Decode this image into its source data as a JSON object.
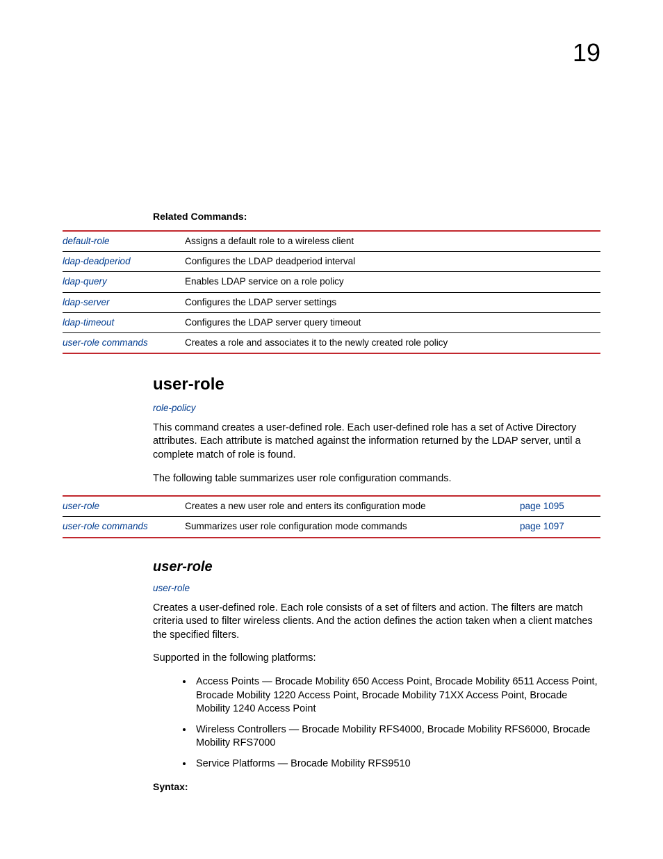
{
  "pageNumber": "19",
  "relatedCommands": {
    "heading": "Related Commands:",
    "rows": [
      {
        "cmd": "default-role",
        "desc": "Assigns a default role to a wireless client"
      },
      {
        "cmd": "ldap-deadperiod",
        "desc": "Configures the LDAP deadperiod interval"
      },
      {
        "cmd": "ldap-query",
        "desc": "Enables LDAP service on a role policy"
      },
      {
        "cmd": "ldap-server",
        "desc": "Configures the LDAP server settings"
      },
      {
        "cmd": "ldap-timeout",
        "desc": "Configures the LDAP server query timeout"
      },
      {
        "cmd": "user-role commands",
        "desc": "Creates a role and associates it to the newly created role policy"
      }
    ]
  },
  "userRoleSection": {
    "heading": "user-role",
    "xref": "role-policy",
    "para1": "This command creates a user-defined role. Each user-defined role has a set of Active Directory attributes. Each attribute is matched against the information returned by the LDAP server, until a complete match of role is found.",
    "para2": "The following table summarizes user role configuration commands.",
    "tableRows": [
      {
        "cmd": "user-role",
        "desc": "Creates a new user role and enters its configuration mode",
        "page": "page 1095"
      },
      {
        "cmd": "user-role commands",
        "desc": "Summarizes user role configuration mode commands",
        "page": "page 1097"
      }
    ]
  },
  "userRoleSub": {
    "heading": "user-role",
    "xref": "user-role",
    "para1": "Creates a user-defined role. Each role consists of a set of filters and action. The filters are match criteria used to filter wireless clients. And the action defines the action taken when a client matches the specified filters.",
    "para2": "Supported in the following platforms:",
    "bullets": [
      "Access Points — Brocade Mobility 650 Access Point, Brocade Mobility 6511 Access Point, Brocade Mobility 1220 Access Point, Brocade Mobility 71XX Access Point, Brocade Mobility 1240 Access Point",
      "Wireless Controllers — Brocade Mobility RFS4000, Brocade Mobility RFS6000, Brocade Mobility RFS7000",
      "Service Platforms — Brocade Mobility RFS9510"
    ],
    "syntaxLabel": "Syntax:"
  }
}
